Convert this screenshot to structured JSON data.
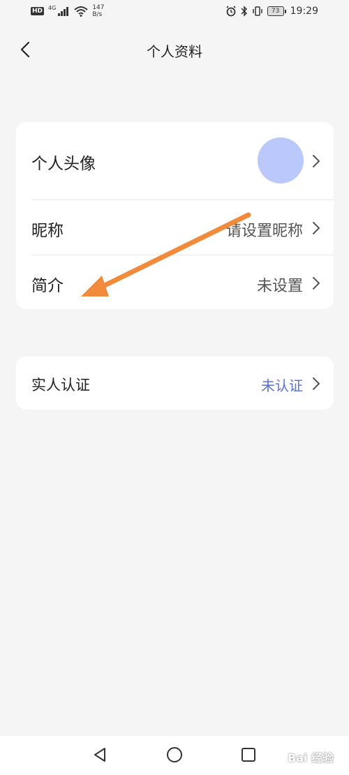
{
  "status_bar": {
    "hd": "HD",
    "signal_label": "4G",
    "net_speed_value": "147",
    "net_speed_unit": "B/s",
    "battery": "73",
    "time": "19:29"
  },
  "nav": {
    "title": "个人资料"
  },
  "profile": {
    "avatar_label": "个人头像",
    "nickname_label": "昵称",
    "nickname_value": "请设置昵称",
    "bio_label": "简介",
    "bio_value": "未设置"
  },
  "verification": {
    "label": "实人认证",
    "value": "未认证",
    "value_color": "#5a6fd4"
  },
  "annotation": {
    "arrow_color": "#f28a3c"
  },
  "watermark": "Bai 经验"
}
